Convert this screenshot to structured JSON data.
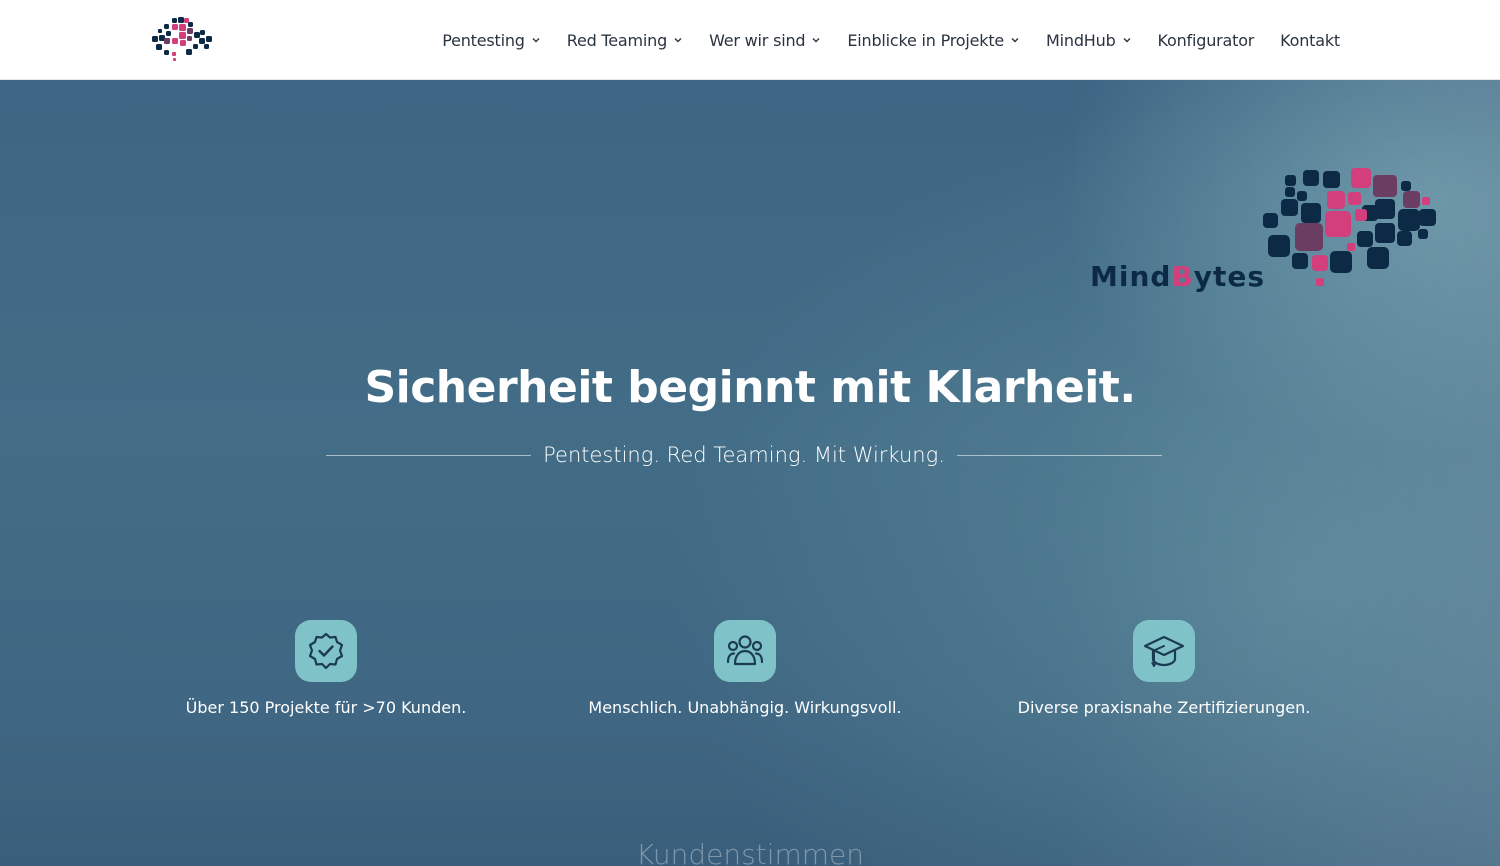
{
  "nav": {
    "items": [
      {
        "label": "Pentesting",
        "dropdown": true
      },
      {
        "label": "Red Teaming",
        "dropdown": true
      },
      {
        "label": "Wer wir sind",
        "dropdown": true
      },
      {
        "label": "Einblicke in Projekte",
        "dropdown": true
      },
      {
        "label": "MindHub",
        "dropdown": true
      },
      {
        "label": "Konfigurator",
        "dropdown": false
      },
      {
        "label": "Kontakt",
        "dropdown": false
      }
    ]
  },
  "brand": {
    "word_start": "Mind",
    "word_highlight": "B",
    "word_end": "ytes",
    "colors": {
      "navy": "#0c2a45",
      "pink": "#d23f7c",
      "purple": "#6b3d62"
    }
  },
  "hero": {
    "headline": "Sicherheit beginnt mit Klarheit.",
    "subline": "Pentesting. Red Teaming. Mit Wirkung."
  },
  "features": [
    {
      "icon": "verified-badge-icon",
      "caption": "Über 150 Projekte für >70 Kunden."
    },
    {
      "icon": "team-icon",
      "caption": "Menschlich. Unabhängig. Wirkungsvoll."
    },
    {
      "icon": "graduation-cap-icon",
      "caption": "Diverse praxisnahe Zertifizierungen."
    }
  ],
  "teaser": {
    "title": "Kundenstimmen"
  },
  "colors": {
    "accent": "#7fc3c9",
    "hero_bg": "#3f6780",
    "nav_text": "#2a3440"
  }
}
